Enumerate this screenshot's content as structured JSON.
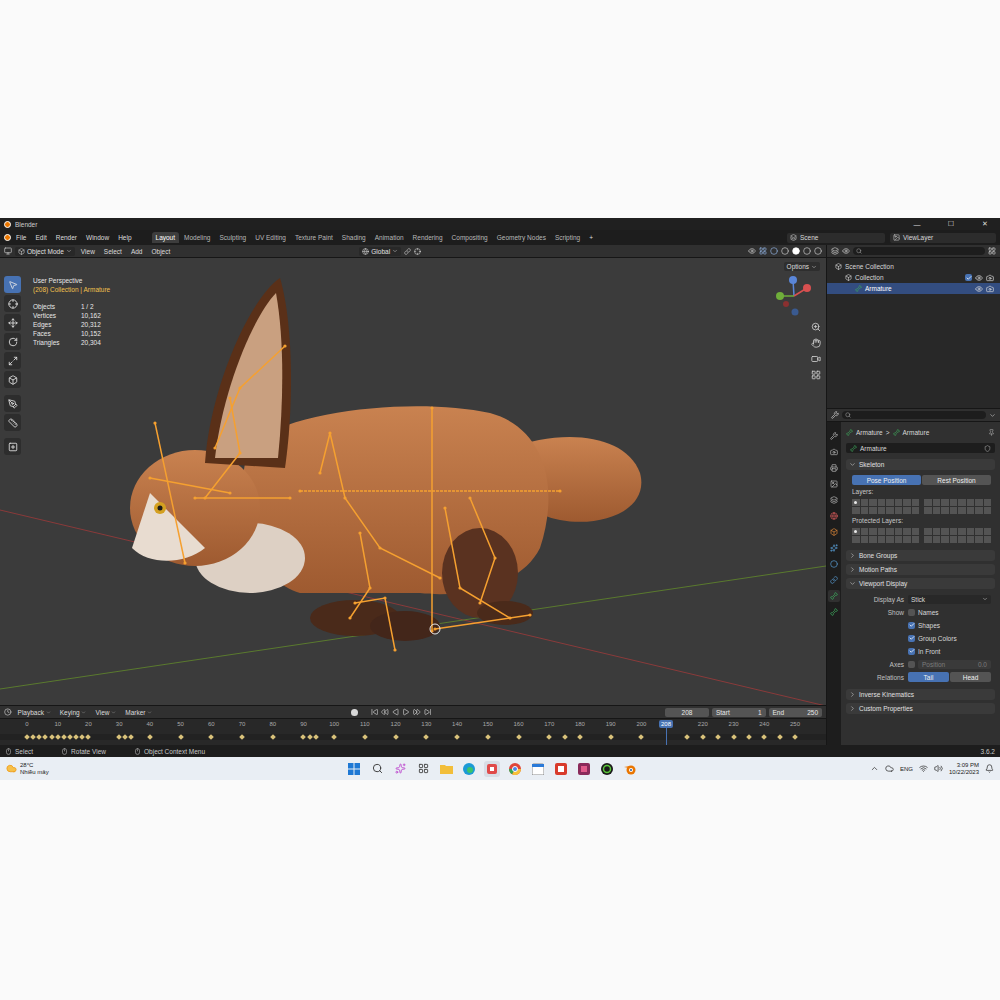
{
  "window": {
    "title": "Blender",
    "controls": [
      "—",
      "☐",
      "✕"
    ]
  },
  "menu": [
    "File",
    "Edit",
    "Render",
    "Window",
    "Help"
  ],
  "workspaces": [
    {
      "label": "Layout",
      "selected": true
    },
    {
      "label": "Modeling",
      "selected": false
    },
    {
      "label": "Sculpting",
      "selected": false
    },
    {
      "label": "UV Editing",
      "selected": false
    },
    {
      "label": "Texture Paint",
      "selected": false
    },
    {
      "label": "Shading",
      "selected": false
    },
    {
      "label": "Animation",
      "selected": false
    },
    {
      "label": "Rendering",
      "selected": false
    },
    {
      "label": "Compositing",
      "selected": false
    },
    {
      "label": "Geometry Nodes",
      "selected": false
    },
    {
      "label": "Scripting",
      "selected": false
    }
  ],
  "add_workspace": "+",
  "scene": "Scene",
  "view_layer": "ViewLayer",
  "viewport_header": {
    "mode": "Object Mode",
    "menus": [
      "View",
      "Select",
      "Add",
      "Object"
    ],
    "orientation": "Global"
  },
  "viewport": {
    "options": "Options",
    "view_name": "User Perspective",
    "context": "(208) Collection | Armature",
    "stats": [
      {
        "label": "Objects",
        "value": "1 / 2"
      },
      {
        "label": "Vertices",
        "value": "10,162"
      },
      {
        "label": "Edges",
        "value": "20,312"
      },
      {
        "label": "Faces",
        "value": "10,152"
      },
      {
        "label": "Triangles",
        "value": "20,304"
      }
    ],
    "tools": [
      {
        "kind": "select",
        "selected": true
      },
      {
        "kind": "cursor",
        "selected": false
      },
      {
        "kind": "move",
        "selected": false
      },
      {
        "kind": "rotate",
        "selected": false
      },
      {
        "kind": "scale",
        "selected": false
      },
      {
        "kind": "transform",
        "selected": false
      },
      {
        "kind": "annotate",
        "selected": false
      },
      {
        "kind": "measure",
        "selected": false
      },
      {
        "kind": "add-cube",
        "selected": false
      }
    ]
  },
  "outliner": {
    "items": [
      {
        "label": "Scene Collection",
        "kind": "scene",
        "selected": false
      },
      {
        "label": "Collection",
        "kind": "collection",
        "selected": false,
        "checked": true,
        "visible": true
      },
      {
        "label": "Armature",
        "kind": "object",
        "selected": true,
        "visible": true
      }
    ]
  },
  "properties": {
    "breadcrumb": [
      "Armature",
      "Armature"
    ],
    "separator": ">",
    "name": "Armature",
    "tabs": [
      {
        "kind": "tool",
        "selected": false
      },
      {
        "kind": "render",
        "selected": false
      },
      {
        "kind": "output",
        "selected": false
      },
      {
        "kind": "view-layer",
        "selected": false
      },
      {
        "kind": "scene",
        "selected": false
      },
      {
        "kind": "world",
        "selected": false
      },
      {
        "kind": "object",
        "selected": false
      },
      {
        "kind": "particles",
        "selected": false
      },
      {
        "kind": "physics",
        "selected": false
      },
      {
        "kind": "constraints",
        "selected": false
      },
      {
        "kind": "data",
        "selected": true
      },
      {
        "kind": "bone",
        "selected": false
      }
    ],
    "skeleton": {
      "title": "Skeleton",
      "expanded": true,
      "positions": [
        {
          "label": "Pose Position",
          "selected": true
        },
        {
          "label": "Rest Position",
          "selected": false
        }
      ],
      "layers_label": "Layers:",
      "layers": [
        true,
        false,
        false,
        false,
        false,
        false,
        false,
        false,
        false,
        false,
        false,
        false,
        false,
        false,
        false,
        false,
        false,
        false,
        false,
        false,
        false,
        false,
        false,
        false,
        false,
        false,
        false,
        false,
        false,
        false,
        false,
        false
      ],
      "protected_label": "Protected Layers:",
      "protected_layers": [
        true,
        false,
        false,
        false,
        false,
        false,
        false,
        false,
        false,
        false,
        false,
        false,
        false,
        false,
        false,
        false,
        false,
        false,
        false,
        false,
        false,
        false,
        false,
        false,
        false,
        false,
        false,
        false,
        false,
        false,
        false,
        false
      ]
    },
    "panels_a": [
      {
        "title": "Bone Groups",
        "expanded": false
      },
      {
        "title": "Motion Paths",
        "expanded": false
      }
    ],
    "viewport_display": {
      "title": "Viewport Display",
      "expanded": true,
      "display_as_label": "Display As",
      "display_as": "Stick",
      "show_label": "Show",
      "show": [
        {
          "label": "Names",
          "checked": false
        },
        {
          "label": "Shapes",
          "checked": true
        },
        {
          "label": "Group Colors",
          "checked": true
        },
        {
          "label": "In Front",
          "checked": true
        }
      ],
      "axes_label": "Axes",
      "axes": {
        "checked": false,
        "position_label": "Position",
        "position": "0.0",
        "disabled": true
      },
      "relations_label": "Relations",
      "relations": [
        {
          "label": "Tail",
          "selected": true
        },
        {
          "label": "Head",
          "selected": false
        }
      ]
    },
    "panels_b": [
      {
        "title": "Inverse Kinematics",
        "expanded": false
      },
      {
        "title": "Custom Properties",
        "expanded": false
      }
    ]
  },
  "timeline": {
    "menus": [
      "Playback",
      "Keying",
      "View",
      "Marker"
    ],
    "current_frame": "208",
    "start_label": "Start",
    "start": "1",
    "end_label": "End",
    "end": "250",
    "ticks": [
      "0",
      "10",
      "20",
      "30",
      "40",
      "50",
      "60",
      "70",
      "80",
      "90",
      "100",
      "110",
      "120",
      "130",
      "140",
      "150",
      "160",
      "170",
      "180",
      "190",
      "200",
      "220",
      "230",
      "240",
      "250"
    ],
    "playhead": {
      "label": "208",
      "level": 0.832
    },
    "keyframes": [
      0,
      2,
      4,
      6,
      8,
      10,
      12,
      14,
      16,
      18,
      20,
      30,
      32,
      34,
      40,
      50,
      60,
      70,
      80,
      90,
      92,
      94,
      100,
      110,
      120,
      130,
      140,
      150,
      160,
      170,
      175,
      180,
      190,
      200,
      215,
      220,
      225,
      230,
      235,
      240,
      245,
      250
    ]
  },
  "status_bar": {
    "items": [
      "Select",
      "Rotate View",
      "Object Context Menu"
    ],
    "version": "3.6.2"
  },
  "taskbar": {
    "temperature": "28°C",
    "condition": "Nhiều mây",
    "language": "ENG",
    "time": "3:09 PM",
    "date": "10/22/2023"
  }
}
